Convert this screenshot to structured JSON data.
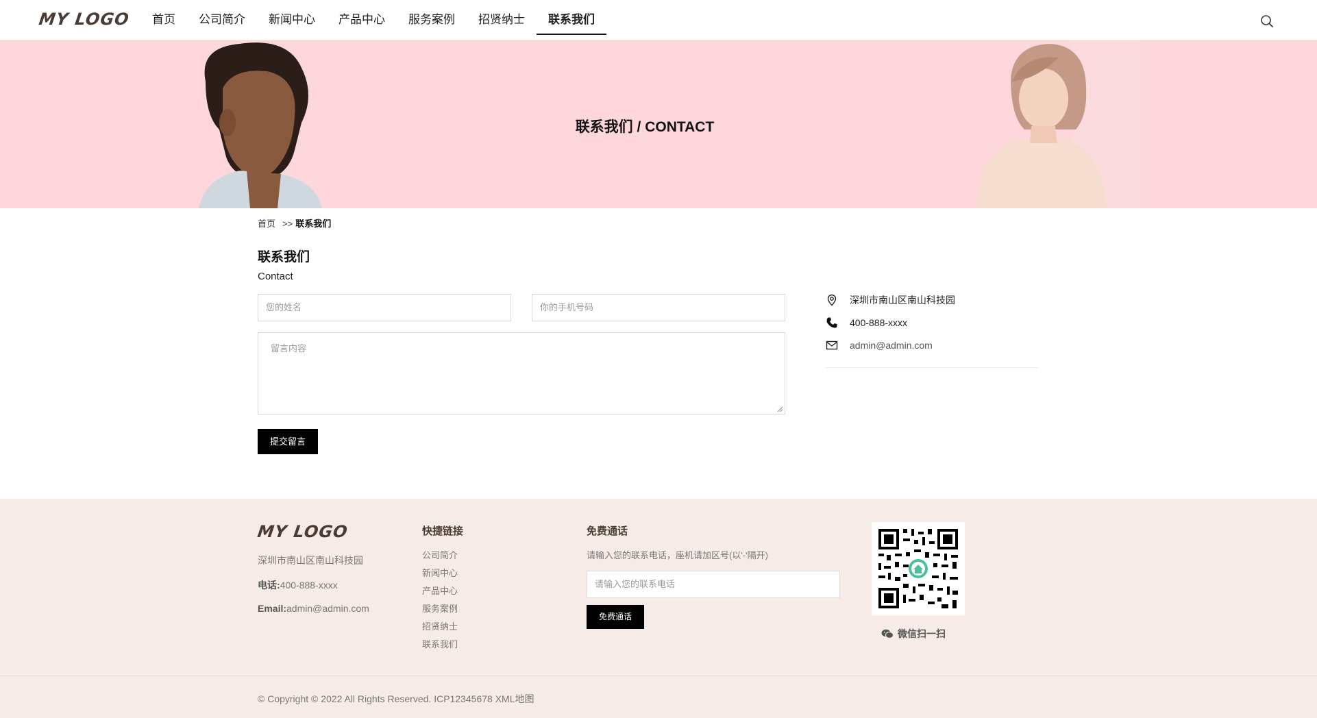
{
  "header": {
    "logo": "MY LOGO",
    "nav": [
      "首页",
      "公司简介",
      "新闻中心",
      "产品中心",
      "服务案例",
      "招贤纳士",
      "联系我们"
    ],
    "active_index": 6
  },
  "banner": {
    "title": "联系我们 / CONTACT",
    "bg_color": "#fdd7dc"
  },
  "breadcrumb": {
    "home": "首页",
    "separator": ">>",
    "current": "联系我们"
  },
  "main": {
    "title": "联系我们",
    "subtitle": "Contact",
    "name_placeholder": "您的姓名",
    "phone_placeholder": "你的手机号码",
    "message_placeholder": "留言内容",
    "submit_label": "提交留言"
  },
  "contact": {
    "address": "深圳市南山区南山科技园",
    "phone": "400-888-xxxx",
    "email": "admin@admin.com"
  },
  "footer": {
    "logo": "MY LOGO",
    "address": "深圳市南山区南山科技园",
    "phone_label": "电话:",
    "phone": "400-888-xxxx",
    "email_label": "Email:",
    "email": "admin@admin.com",
    "links_title": "快捷链接",
    "links": [
      "公司简介",
      "新闻中心",
      "产品中心",
      "服务案例",
      "招贤纳士",
      "联系我们"
    ],
    "call_title": "免费通话",
    "call_desc": "请输入您的联系电话，座机请加区号(以'-'隔开)",
    "call_placeholder": "请输入您的联系电话",
    "call_button": "免费通话",
    "qr_caption": "微信扫一扫",
    "copyright": "© Copyright © 2022 All Rights Reserved. ICP12345678 XML地图"
  },
  "colors": {
    "footer_bg": "#f6ebe6",
    "brand_brown": "#4a3b34",
    "button_bg": "#000000"
  }
}
